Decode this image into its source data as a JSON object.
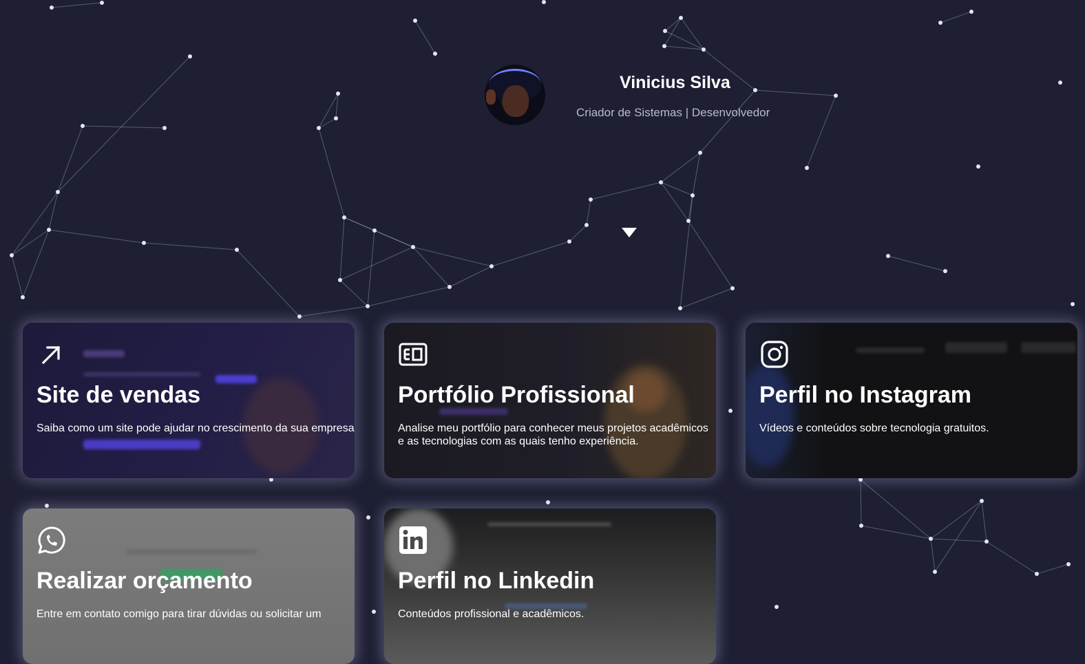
{
  "profile": {
    "name": "Vinicius Silva",
    "role": "Criador de Sistemas | Desenvolvedor"
  },
  "cards": [
    {
      "title": "Site de vendas",
      "description": "Saiba como um site pode ajudar no crescimento da sua empresa",
      "icon": "arrow-up-right-icon"
    },
    {
      "title": "Portfólio Profissional",
      "description": "Analise meu portfólio para conhecer meus projetos acadêmicos e as tecnologias com as quais tenho experiência.",
      "icon": "newspaper-icon"
    },
    {
      "title": "Perfil no Instagram",
      "description": "Vídeos e conteúdos sobre tecnologia gratuitos.",
      "icon": "instagram-icon"
    },
    {
      "title": "Realizar orçamento",
      "description": "Entre em contato comigo para tirar dúvidas ou solicitar um",
      "icon": "whatsapp-icon"
    },
    {
      "title": "Perfil no Linkedin",
      "description": "Conteúdos profissional e acadêmicos.",
      "icon": "linkedin-icon"
    }
  ],
  "colors": {
    "background": "#1e1f33",
    "text": "#ffffff",
    "muted": "#b9bccb",
    "card_glow": "#c8cdff"
  }
}
